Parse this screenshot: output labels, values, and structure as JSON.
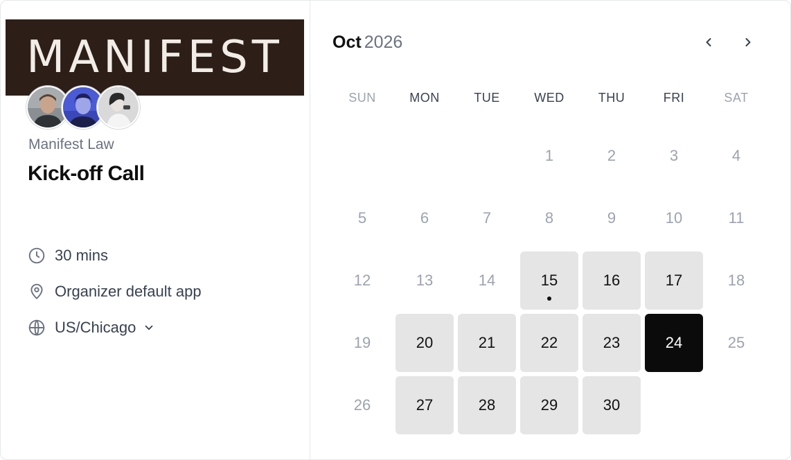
{
  "brand": {
    "logo_text": "MANIFEST"
  },
  "event": {
    "organization": "Manifest Law",
    "title": "Kick-off Call",
    "duration": "30 mins",
    "location": "Organizer default app",
    "timezone": "US/Chicago"
  },
  "icons": {
    "duration": "clock-icon",
    "location": "map-pin-icon",
    "timezone": "globe-icon",
    "timezone_toggle": "chevron-down-icon",
    "prev": "chevron-left-icon",
    "next": "chevron-right-icon"
  },
  "calendar": {
    "month": "Oct",
    "year": "2026",
    "weekdays": [
      {
        "label": "SUN",
        "muted": true
      },
      {
        "label": "MON",
        "muted": false
      },
      {
        "label": "TUE",
        "muted": false
      },
      {
        "label": "WED",
        "muted": false
      },
      {
        "label": "THU",
        "muted": false
      },
      {
        "label": "FRI",
        "muted": false
      },
      {
        "label": "SAT",
        "muted": true
      }
    ],
    "weeks": [
      [
        null,
        null,
        null,
        {
          "day": "1",
          "state": "unavailable"
        },
        {
          "day": "2",
          "state": "unavailable"
        },
        {
          "day": "3",
          "state": "unavailable"
        },
        {
          "day": "4",
          "state": "unavailable"
        }
      ],
      [
        {
          "day": "5",
          "state": "unavailable"
        },
        {
          "day": "6",
          "state": "unavailable"
        },
        {
          "day": "7",
          "state": "unavailable"
        },
        {
          "day": "8",
          "state": "unavailable"
        },
        {
          "day": "9",
          "state": "unavailable"
        },
        {
          "day": "10",
          "state": "unavailable"
        },
        {
          "day": "11",
          "state": "unavailable"
        }
      ],
      [
        {
          "day": "12",
          "state": "unavailable"
        },
        {
          "day": "13",
          "state": "unavailable"
        },
        {
          "day": "14",
          "state": "unavailable"
        },
        {
          "day": "15",
          "state": "available",
          "today": true
        },
        {
          "day": "16",
          "state": "available"
        },
        {
          "day": "17",
          "state": "available"
        },
        {
          "day": "18",
          "state": "unavailable"
        }
      ],
      [
        {
          "day": "19",
          "state": "unavailable"
        },
        {
          "day": "20",
          "state": "available"
        },
        {
          "day": "21",
          "state": "available"
        },
        {
          "day": "22",
          "state": "available"
        },
        {
          "day": "23",
          "state": "available"
        },
        {
          "day": "24",
          "state": "selected"
        },
        {
          "day": "25",
          "state": "unavailable"
        }
      ],
      [
        {
          "day": "26",
          "state": "unavailable"
        },
        {
          "day": "27",
          "state": "available"
        },
        {
          "day": "28",
          "state": "available"
        },
        {
          "day": "29",
          "state": "available"
        },
        {
          "day": "30",
          "state": "available"
        },
        null,
        null
      ]
    ]
  },
  "colors": {
    "logo_bg": "#2d1f18",
    "available_bg": "#e5e5e5",
    "selected_bg": "#0b0b0b",
    "muted_text": "#9ca3af"
  }
}
